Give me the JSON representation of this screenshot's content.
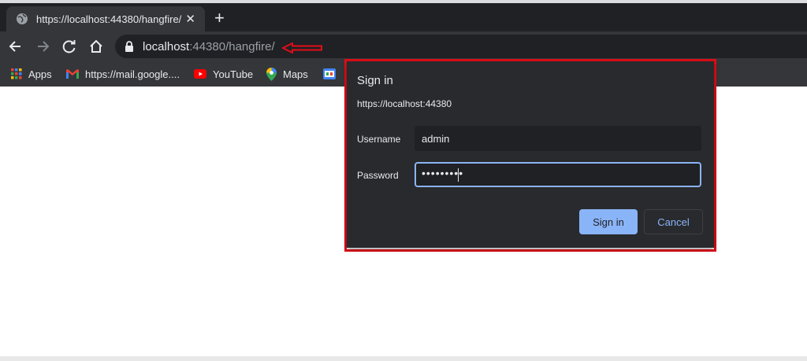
{
  "browser": {
    "tab": {
      "title": "https://localhost:44380/hangfire/",
      "close": "✕"
    },
    "new_tab": "+",
    "address": {
      "host": "localhost",
      "path": ":44380/hangfire/"
    },
    "bookmarks": [
      {
        "label": "Apps",
        "icon": "apps-grid-icon"
      },
      {
        "label": "https://mail.google....",
        "icon": "gmail-icon"
      },
      {
        "label": "YouTube",
        "icon": "youtube-icon"
      },
      {
        "label": "Maps",
        "icon": "maps-pin-icon"
      },
      {
        "label": "",
        "icon": "google-edu-icon"
      }
    ]
  },
  "dialog": {
    "title": "Sign in",
    "origin": "https://localhost:44380",
    "username_label": "Username",
    "username_value": "admin",
    "password_label": "Password",
    "password_value": "•••••••••",
    "sign_in_button": "Sign in",
    "cancel_button": "Cancel"
  },
  "colors": {
    "annotation_red": "#e30d18",
    "accent_blue": "#8ab4f8",
    "dark_bg": "#202124",
    "toolbar_bg": "#35363a"
  }
}
